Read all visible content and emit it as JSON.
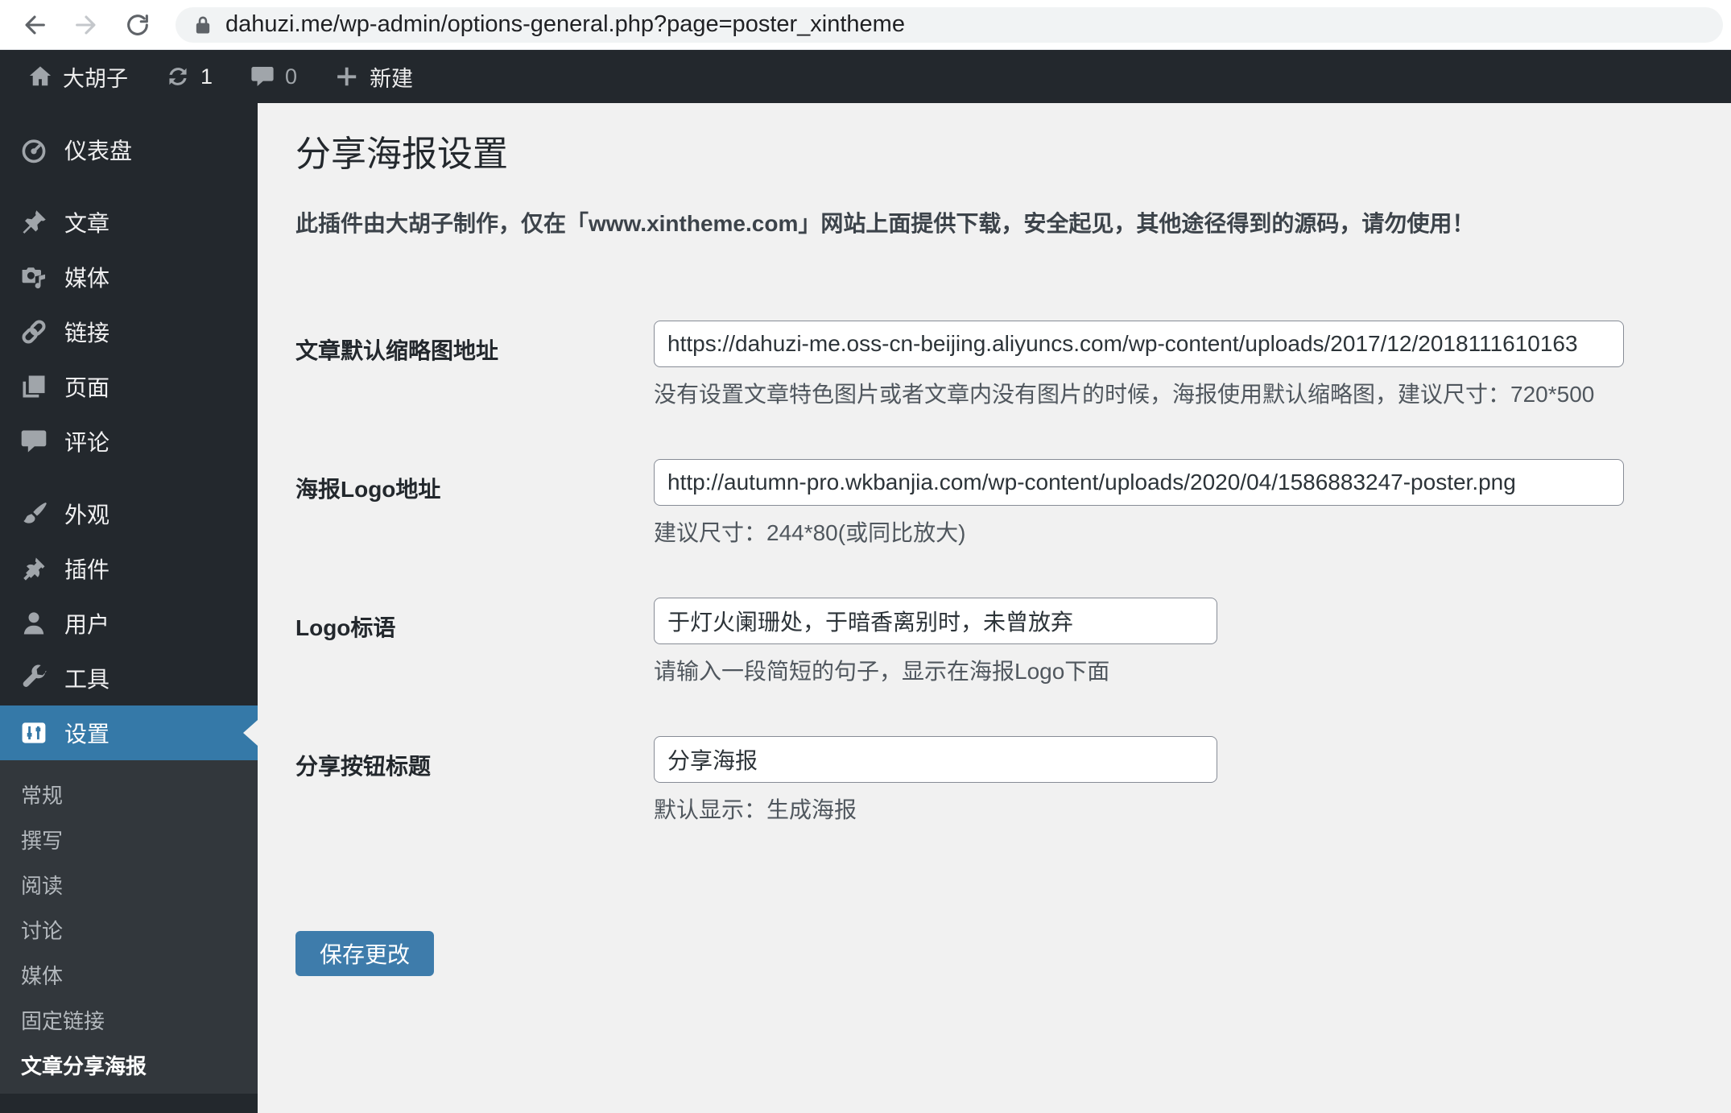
{
  "browser": {
    "url": "dahuzi.me/wp-admin/options-general.php?page=poster_xintheme"
  },
  "admin_bar": {
    "site_name": "大胡子",
    "updates_count": "1",
    "comments_count": "0",
    "new_label": "新建"
  },
  "sidebar": {
    "items": [
      {
        "label": "仪表盘",
        "icon": "dashboard-icon"
      },
      {
        "label": "文章",
        "icon": "pushpin-icon"
      },
      {
        "label": "媒体",
        "icon": "media-icon"
      },
      {
        "label": "链接",
        "icon": "link-icon"
      },
      {
        "label": "页面",
        "icon": "pages-icon"
      },
      {
        "label": "评论",
        "icon": "comment-icon"
      },
      {
        "label": "外观",
        "icon": "appearance-icon"
      },
      {
        "label": "插件",
        "icon": "plugin-icon"
      },
      {
        "label": "用户",
        "icon": "users-icon"
      },
      {
        "label": "工具",
        "icon": "tools-icon"
      },
      {
        "label": "设置",
        "icon": "settings-icon",
        "active": true
      }
    ],
    "submenu": {
      "items": [
        {
          "label": "常规"
        },
        {
          "label": "撰写"
        },
        {
          "label": "阅读"
        },
        {
          "label": "讨论"
        },
        {
          "label": "媒体"
        },
        {
          "label": "固定链接"
        },
        {
          "label": "文章分享海报",
          "current": true
        }
      ]
    }
  },
  "main": {
    "title": "分享海报设置",
    "notice": "此插件由大胡子制作，仅在「www.xintheme.com」网站上面提供下载，安全起见，其他途径得到的源码，请勿使用！",
    "fields": [
      {
        "label": "文章默认缩略图地址",
        "value": "https://dahuzi-me.oss-cn-beijing.aliyuncs.com/wp-content/uploads/2017/12/2018111610163",
        "help": "没有设置文章特色图片或者文章内没有图片的时候，海报使用默认缩略图，建议尺寸：720*500"
      },
      {
        "label": "海报Logo地址",
        "value": "http://autumn-pro.wkbanjia.com/wp-content/uploads/2020/04/1586883247-poster.png",
        "help": "建议尺寸：244*80(或同比放大)"
      },
      {
        "label": "Logo标语",
        "value": "于灯火阑珊处，于暗香离别时，未曾放弃",
        "help": "请输入一段简短的句子，显示在海报Logo下面"
      },
      {
        "label": "分享按钮标题",
        "value": "分享海报",
        "help": "默认显示：生成海报"
      }
    ],
    "save_button": "保存更改"
  },
  "colors": {
    "admin_dark": "#23282d",
    "submenu_dark": "#32373c",
    "accent_blue": "#3579a8",
    "button_blue": "#3e7cab",
    "content_bg": "#f1f1f1"
  }
}
